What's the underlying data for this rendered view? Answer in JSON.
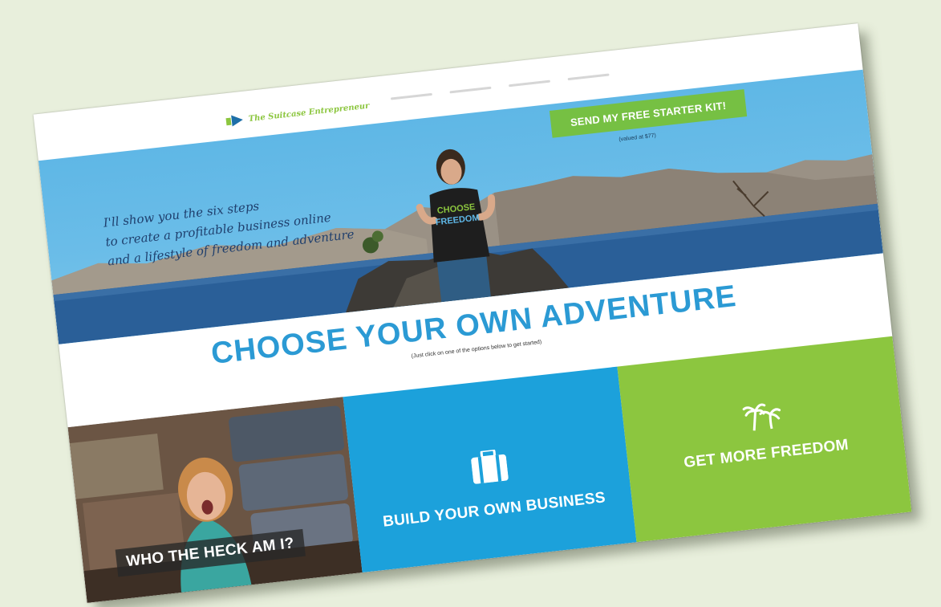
{
  "header": {
    "brand": "The Suitcase Entrepreneur",
    "logo_icon": "logo-icon"
  },
  "hero": {
    "tagline": [
      "I'll show you the six steps",
      "to create a profitable business online",
      "and a lifestyle of freedom and adventure"
    ],
    "cta_label": "SEND MY FREE STARTER KIT!",
    "cta_note": "(valued at $77)",
    "shirt_text": "CHOOSE FREEDOM"
  },
  "main": {
    "title": "CHOOSE YOUR OWN ADVENTURE",
    "subtitle": "(Just click on one of the options below to get started)"
  },
  "tiles": [
    {
      "label": "WHO THE HECK AM I?",
      "icon": "photo"
    },
    {
      "label": "BUILD YOUR OWN BUSINESS",
      "icon": "suitcase-icon"
    },
    {
      "label": "GET MORE FREEDOM",
      "icon": "palm-trees-icon"
    }
  ],
  "colors": {
    "page_bg": "#e8efdc",
    "sky": "#6bbde8",
    "cta_green": "#76c043",
    "title_blue": "#2b9ad4",
    "tile_blue": "#1ca1db",
    "tile_green": "#8cc63f"
  }
}
